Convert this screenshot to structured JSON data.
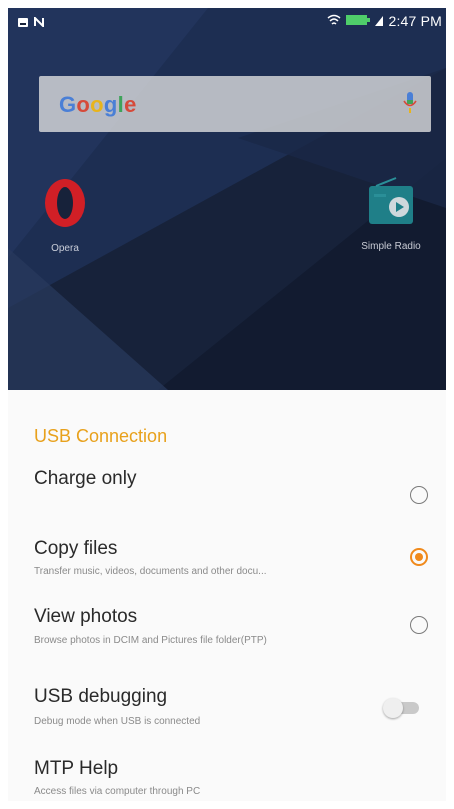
{
  "status_bar": {
    "time": "2:47 PM"
  },
  "search": {
    "logo": "Google"
  },
  "apps": [
    {
      "label": "Opera",
      "icon": "opera-icon"
    },
    {
      "label": "Simple Radio",
      "icon": "radio-icon"
    }
  ],
  "usb_dialog": {
    "title": "USB Connection",
    "options": [
      {
        "title": "Charge only",
        "subtitle": "",
        "selected": false
      },
      {
        "title": "Copy files",
        "subtitle": "Transfer music, videos, documents and other docu...",
        "selected": true
      },
      {
        "title": "View photos",
        "subtitle": "Browse photos in DCIM and Pictures file folder(PTP)",
        "selected": false
      }
    ],
    "debugging": {
      "title": "USB debugging",
      "subtitle": "Debug mode when USB is connected",
      "enabled": false
    },
    "help": {
      "title": "MTP Help",
      "subtitle": "Access files via computer through PC"
    }
  },
  "colors": {
    "accent": "#f08a1c",
    "title": "#e8a11c",
    "wallpaper": "#17223a"
  }
}
